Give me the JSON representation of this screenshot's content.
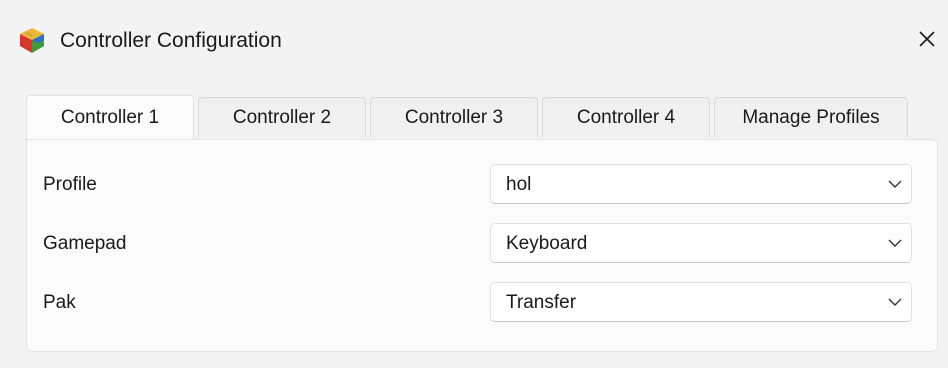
{
  "window": {
    "title": "Controller Configuration",
    "app_icon": "cube-icon",
    "close_icon": "close-icon"
  },
  "tabs": [
    {
      "label": "Controller 1",
      "active": true
    },
    {
      "label": "Controller 2",
      "active": false
    },
    {
      "label": "Controller 3",
      "active": false
    },
    {
      "label": "Controller 4",
      "active": false
    },
    {
      "label": "Manage Profiles",
      "active": false
    }
  ],
  "settings": [
    {
      "label": "Profile",
      "value": "hol"
    },
    {
      "label": "Gamepad",
      "value": "Keyboard"
    },
    {
      "label": "Pak",
      "value": "Transfer"
    }
  ],
  "colors": {
    "window_bg": "#f3f3f3",
    "panel_bg": "#fbfbfb",
    "combo_bg": "#ffffff"
  }
}
